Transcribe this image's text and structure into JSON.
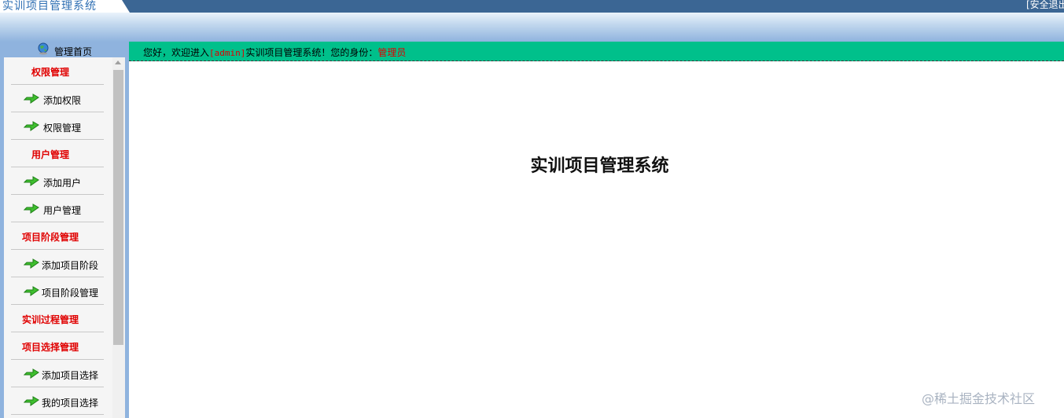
{
  "header": {
    "app_title": "实训项目管理系统",
    "logout_label": "[安全退出"
  },
  "home": {
    "label": "管理首页"
  },
  "sidebar": {
    "items": [
      {
        "type": "group",
        "label": "权限管理"
      },
      {
        "type": "item",
        "label": "添加权限"
      },
      {
        "type": "item",
        "label": "权限管理"
      },
      {
        "type": "group",
        "label": "用户管理"
      },
      {
        "type": "item",
        "label": "添加用户"
      },
      {
        "type": "item",
        "label": "用户管理"
      },
      {
        "type": "group",
        "label": "项目阶段管理"
      },
      {
        "type": "item",
        "label": "添加项目阶段"
      },
      {
        "type": "item",
        "label": "项目阶段管理"
      },
      {
        "type": "group",
        "label": "实训过程管理"
      },
      {
        "type": "group",
        "label": "项目选择管理"
      },
      {
        "type": "item",
        "label": "添加项目选择"
      },
      {
        "type": "item",
        "label": "我的项目选择"
      }
    ]
  },
  "welcome": {
    "prefix": "您好，欢迎进入",
    "user": "[admin]",
    "suffix": "实训项目管理系统！您的身份：",
    "role": "管理员"
  },
  "main": {
    "title": "实训项目管理系统"
  },
  "watermark": "@稀土掘金技术社区",
  "colors": {
    "topbar": "#3b6694",
    "accent_green": "#00c08b",
    "group_red": "#e00000"
  }
}
